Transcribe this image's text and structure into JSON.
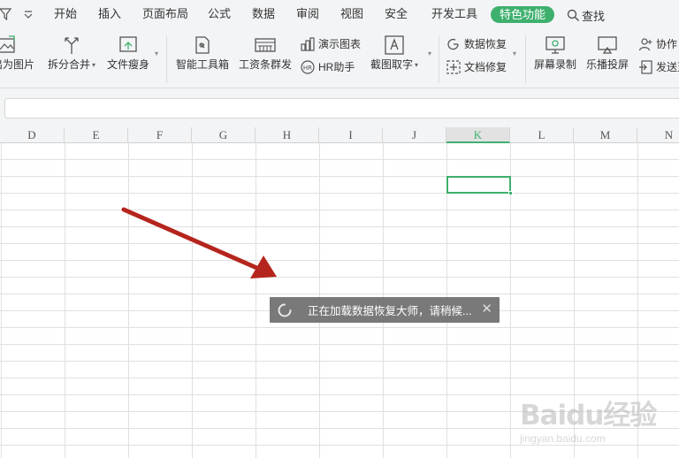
{
  "menu": {
    "items": [
      "开始",
      "插入",
      "页面布局",
      "公式",
      "数据",
      "审阅",
      "视图",
      "安全",
      "开发工具"
    ],
    "active": "特色功能",
    "search": "查找"
  },
  "ribbon": {
    "export_pic": "出为图片",
    "split_merge": "拆分合并",
    "file_slim": "文件瘦身",
    "smart_toolbox": "智能工具箱",
    "payroll": "工资条群发",
    "demo_chart": "演示图表",
    "hr_helper": "HR助手",
    "screenshot_ocr": "截图取字",
    "data_recovery": "数据恢复",
    "doc_repair": "文档修复",
    "screen_record": "屏幕录制",
    "cast": "乐播投屏",
    "collab": "协作",
    "send": "发送至"
  },
  "columns": [
    "D",
    "E",
    "F",
    "G",
    "H",
    "I",
    "J",
    "K",
    "L",
    "M",
    "N"
  ],
  "active_column": "K",
  "toast": {
    "message": "正在加载数据恢复大师，请稍候...",
    "close": "✕"
  },
  "watermark": {
    "brand": "Baidu经验",
    "url": "jingyan.baidu.com"
  },
  "colors": {
    "accent": "#3eb06e",
    "arrow": "#b5251d"
  }
}
